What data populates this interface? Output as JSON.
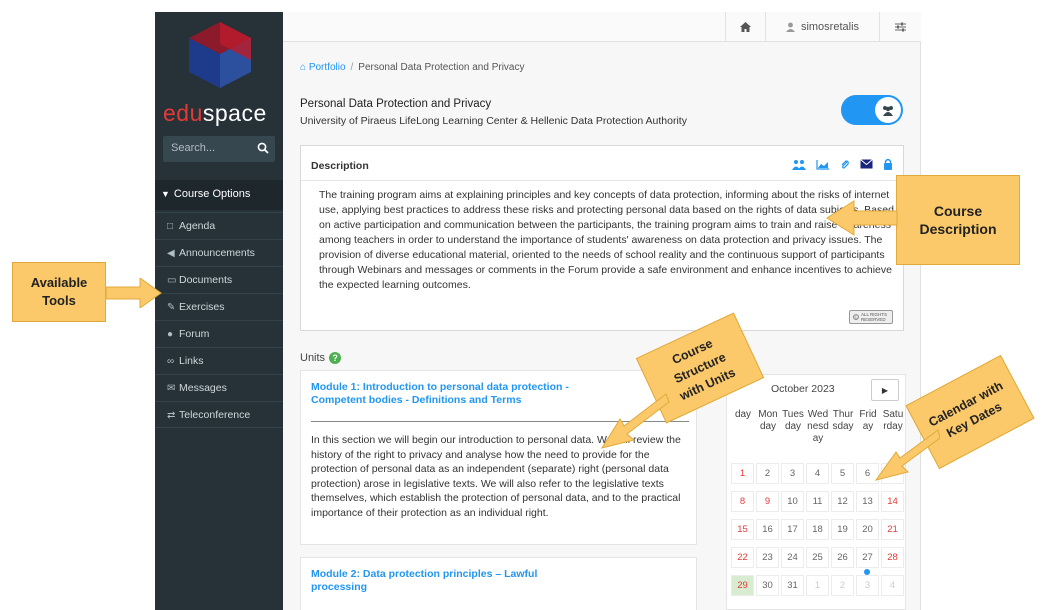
{
  "sidebar": {
    "brand_edu": "edu",
    "brand_space": "space",
    "search_placeholder": "Search...",
    "section_label": "Course Options",
    "items": [
      {
        "label": "Agenda",
        "icon": "calendar-icon"
      },
      {
        "label": "Announcements",
        "icon": "megaphone-icon"
      },
      {
        "label": "Documents",
        "icon": "folder-icon"
      },
      {
        "label": "Exercises",
        "icon": "edit-icon"
      },
      {
        "label": "Forum",
        "icon": "chat-icon"
      },
      {
        "label": "Links",
        "icon": "link-icon"
      },
      {
        "label": "Messages",
        "icon": "envelope-icon"
      },
      {
        "label": "Teleconference",
        "icon": "exchange-icon"
      }
    ]
  },
  "topbar": {
    "username": "simosretalis"
  },
  "breadcrumb": {
    "home": "Portfolio",
    "current": "Personal Data Protection and Privacy"
  },
  "course": {
    "title": "Personal Data Protection and Privacy",
    "institution": "University of Piraeus LifeLong Learning Center & Hellenic Data Protection Authority",
    "description_heading": "Description",
    "description": "The training program aims at explaining principles and key concepts of data protection, informing about the risks of internet use, applying best practices to address these risks and protecting personal data based on the rights of data subjects. Based on active participation and communication between the participants, the training program aims to train and raise awareness among teachers in order to understand the importance of students' awareness on data protection and privacy issues. The provision of diverse educational material, oriented to the needs of school reality and the continuous support of participants through Webinars and messages or comments in the Forum provide a safe environment and enhance incentives to achieve the expected learning outcomes.",
    "license_badge": "ALL RIGHTS RESERVED"
  },
  "units": {
    "heading": "Units",
    "items": [
      {
        "title": "Module 1: Introduction to personal data protection - Competent bodies - Definitions and Terms",
        "text": "In this section we will begin our introduction to personal data. We will review the history of the right to privacy and analyse how the need to provide for the protection of personal data as an independent (separate) right (personal data protection) arose in legislative texts. We will also refer to the legislative texts themselves, which establish the protection of personal data, and to the practical importance of their protection as an individual right."
      },
      {
        "title": "Module 2: Data protection principles – Lawful processing",
        "text": ""
      }
    ]
  },
  "calendar": {
    "month": "October 2023",
    "next_label": "▶",
    "weekdays": [
      "Sunday",
      "Monday",
      "Tuesday",
      "Wednesday",
      "Thursday",
      "Friday",
      "Saturday"
    ],
    "weekday_display": [
      "day",
      "Mon day",
      "Tues day",
      "Wed nesd ay",
      "Thur sday",
      "Frid ay",
      "Satu rday"
    ],
    "weeks": [
      [
        "1",
        "2",
        "3",
        "4",
        "5",
        "6",
        "7"
      ],
      [
        "8",
        "9",
        "10",
        "11",
        "12",
        "13",
        "14"
      ],
      [
        "15",
        "16",
        "17",
        "18",
        "19",
        "20",
        "21"
      ],
      [
        "22",
        "23",
        "24",
        "25",
        "26",
        "27",
        "28"
      ],
      [
        "29",
        "30",
        "31",
        "1",
        "2",
        "3",
        "4"
      ]
    ],
    "today": "29",
    "event_day": "27"
  },
  "annotations": {
    "tools": "Available Tools",
    "description": "Course Description",
    "structure": "Course Structure with Units",
    "calendar": "Calendar with Key Dates"
  },
  "colors": {
    "sidebar_bg": "#263238",
    "accent": "#2196f3",
    "brand_red": "#e53935",
    "callout": "#fbc96a"
  }
}
